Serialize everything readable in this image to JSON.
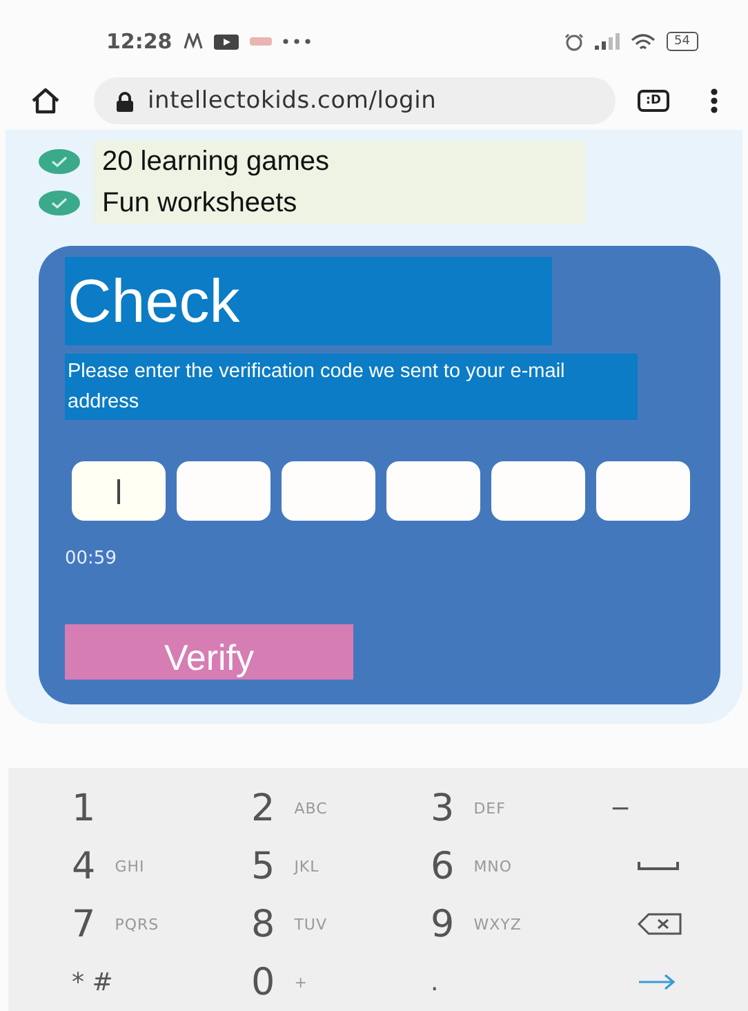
{
  "status_bar": {
    "time": "12:28",
    "battery": "54"
  },
  "browser": {
    "url": "intellectokids.com/login",
    "tab_badge": ":D"
  },
  "features": [
    {
      "label": "20 learning games",
      "checked": true
    },
    {
      "label": "Fun worksheets",
      "checked": true
    }
  ],
  "card": {
    "title": "Check",
    "description": "Please enter the verification code we sent to your e-mail address",
    "code_boxes": [
      {
        "focused": true
      },
      {
        "focused": false
      },
      {
        "focused": false
      },
      {
        "focused": false
      },
      {
        "focused": false
      },
      {
        "focused": false
      }
    ],
    "timer": "00:59",
    "button": "Verify"
  },
  "keyboard": [
    {
      "kind": "digit",
      "main": "1"
    },
    {
      "kind": "digit",
      "main": "2",
      "letters": "ABC"
    },
    {
      "kind": "digit",
      "main": "3",
      "letters": "DEF"
    },
    {
      "kind": "symbol",
      "main": "−"
    },
    {
      "kind": "digit",
      "main": "4",
      "letters": "GHI"
    },
    {
      "kind": "digit",
      "main": "5",
      "letters": "JKL"
    },
    {
      "kind": "digit",
      "main": "6",
      "letters": "MNO"
    },
    {
      "kind": "space"
    },
    {
      "kind": "digit",
      "main": "7",
      "letters": "PQRS"
    },
    {
      "kind": "digit",
      "main": "8",
      "letters": "TUV"
    },
    {
      "kind": "digit",
      "main": "9",
      "letters": "WXYZ"
    },
    {
      "kind": "backspace"
    },
    {
      "kind": "symbol",
      "main": "* #"
    },
    {
      "kind": "digit",
      "main": "0",
      "letters": "+"
    },
    {
      "kind": "symbol",
      "main": "."
    },
    {
      "kind": "go"
    }
  ]
}
